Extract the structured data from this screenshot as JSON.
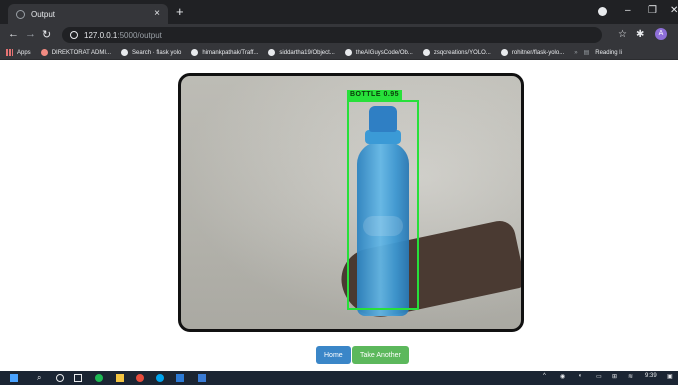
{
  "browser": {
    "tab_title": "Output",
    "tab_close": "×",
    "new_tab": "+",
    "url_host": "127.0.0.1",
    "url_rest": ":5000/output",
    "avatar_letter": "A"
  },
  "bookmarks": [
    {
      "label": "Apps",
      "icon": "apps-icon"
    },
    {
      "label": "DIREKTORAT ADMI...",
      "icon": "direktorat-icon"
    },
    {
      "label": "Search · flask yolo",
      "icon": "github-icon"
    },
    {
      "label": "himankpathak/Traff...",
      "icon": "github-icon"
    },
    {
      "label": "siddartha19/Object...",
      "icon": "github-icon"
    },
    {
      "label": "theAIGuysCode/Ob...",
      "icon": "github-icon"
    },
    {
      "label": "zsqcreations/YOLO...",
      "icon": "github-icon"
    },
    {
      "label": "rohitner/flask-yolo...",
      "icon": "github-icon"
    },
    {
      "label": "Reading li",
      "icon": "reading-list-icon"
    }
  ],
  "detection": {
    "label": "BOTTLE 0.95",
    "color": "#27e03a"
  },
  "buttons": {
    "home": "Home",
    "take_another": "Take Another"
  },
  "taskbar": {
    "time": "9:39"
  },
  "colors": {
    "home_button": "#3a86c8",
    "take_another_button": "#5cb85c",
    "browser_dark": "#202124",
    "toolbar": "#35363a"
  }
}
